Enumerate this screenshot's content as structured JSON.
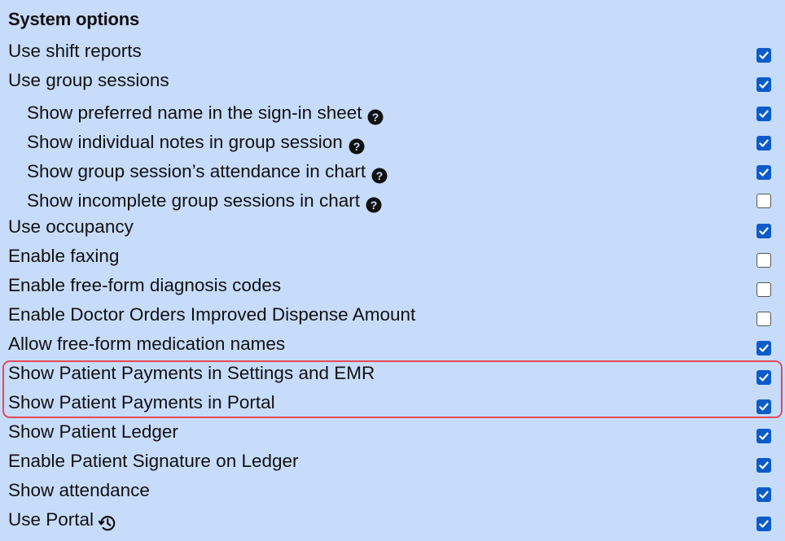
{
  "section": {
    "title": "System options"
  },
  "options": [
    {
      "label": "Use shift reports",
      "checked": true,
      "indent": false,
      "icon": null
    },
    {
      "label": "Use group sessions",
      "checked": true,
      "indent": false,
      "icon": null
    },
    {
      "label": "Show preferred name in the sign-in sheet",
      "checked": true,
      "indent": true,
      "icon": "help-circle-icon"
    },
    {
      "label": "Show individual notes in group session",
      "checked": true,
      "indent": true,
      "icon": "help-circle-icon"
    },
    {
      "label": "Show group session’s attendance in chart",
      "checked": true,
      "indent": true,
      "icon": "help-circle-icon"
    },
    {
      "label": "Show incomplete group sessions in chart",
      "checked": false,
      "indent": true,
      "icon": "help-circle-icon"
    },
    {
      "label": "Use occupancy",
      "checked": true,
      "indent": false,
      "icon": null
    },
    {
      "label": "Enable faxing",
      "checked": false,
      "indent": false,
      "icon": null
    },
    {
      "label": "Enable free-form diagnosis codes",
      "checked": false,
      "indent": false,
      "icon": null
    },
    {
      "label": "Enable Doctor Orders Improved Dispense Amount",
      "checked": false,
      "indent": false,
      "icon": null
    },
    {
      "label": "Allow free-form medication names",
      "checked": true,
      "indent": false,
      "icon": null
    },
    {
      "label": "Show Patient Payments in Settings and EMR",
      "checked": true,
      "indent": false,
      "icon": null
    },
    {
      "label": "Show Patient Payments in Portal",
      "checked": true,
      "indent": false,
      "icon": null
    },
    {
      "label": "Show Patient Ledger",
      "checked": true,
      "indent": false,
      "icon": null
    },
    {
      "label": "Enable Patient Signature on Ledger",
      "checked": true,
      "indent": false,
      "icon": null
    },
    {
      "label": "Show attendance",
      "checked": true,
      "indent": false,
      "icon": null
    },
    {
      "label": "Use Portal",
      "checked": true,
      "indent": false,
      "icon": "history-icon"
    }
  ],
  "colors": {
    "background": "#c7dcfa",
    "checkbox_checked": "#0b5cc9",
    "highlight_border": "#e54a57"
  }
}
